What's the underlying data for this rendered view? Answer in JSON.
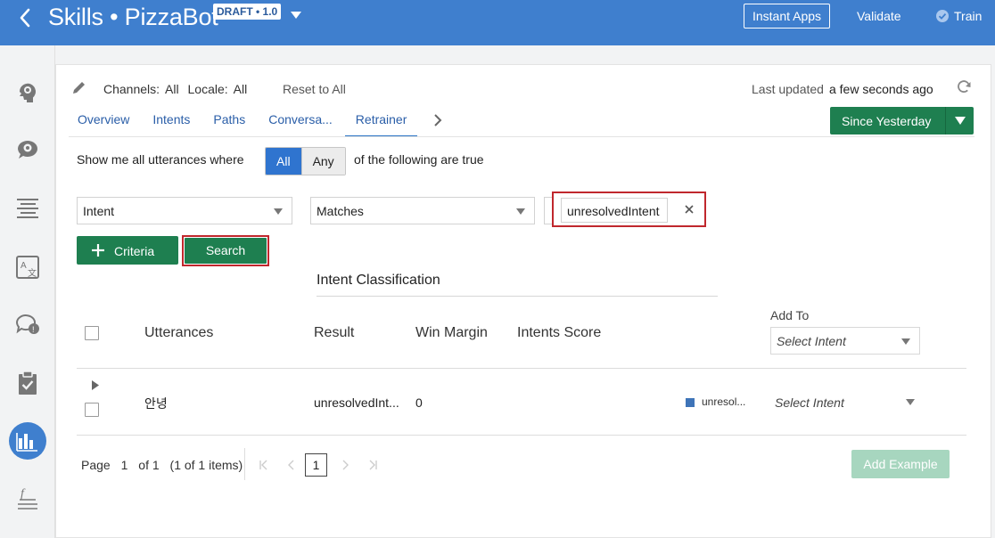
{
  "header": {
    "title": "Skills • PizzaBot",
    "badge": "DRAFT • 1.0",
    "instant_apps": "Instant Apps",
    "validate": "Validate",
    "train": "Train"
  },
  "rail": {
    "icons": [
      "intents-icon",
      "entities-icon",
      "flows-icon",
      "resource-bundles-icon",
      "qna-icon",
      "quality-icon",
      "insights-icon",
      "components-icon"
    ],
    "active": "insights-icon"
  },
  "filters": {
    "channels_label": "Channels:",
    "channels_value": "All",
    "locale_label": "Locale:",
    "locale_value": "All",
    "reset": "Reset to All",
    "last_updated_label": "Last updated",
    "last_updated_value": "a few seconds ago"
  },
  "tabs": [
    {
      "label": "Overview"
    },
    {
      "label": "Intents"
    },
    {
      "label": "Paths"
    },
    {
      "label": "Conversa..."
    },
    {
      "label": "Retrainer",
      "active": true
    }
  ],
  "since_button": "Since Yesterday",
  "query": {
    "prefix": "Show me all utterances where",
    "all": "All",
    "any": "Any",
    "suffix": "of the following are true",
    "field": "Intent",
    "operator": "Matches",
    "value": "unresolvedIntent"
  },
  "buttons": {
    "criteria": "Criteria",
    "search": "Search",
    "add_example": "Add Example"
  },
  "table": {
    "group_header": "Intent Classification",
    "columns": {
      "utterances": "Utterances",
      "result": "Result",
      "win_margin": "Win Margin",
      "intents_score": "Intents Score",
      "add_to": "Add To"
    },
    "add_to_placeholder": "Select Intent",
    "rows": [
      {
        "utterance": "안녕",
        "result": "unresolvedInt...",
        "win_margin": "0",
        "score_label": "unresol...",
        "select": "Select Intent"
      }
    ]
  },
  "pagination": {
    "page_label": "Page",
    "page": "1",
    "of": "of 1",
    "items": "(1 of 1 items)",
    "current": "1"
  },
  "colors": {
    "header_blue": "#3f7fce",
    "primary_green": "#1e7f50",
    "highlight_red": "#c0272d",
    "segment_blue": "#2f74cf"
  }
}
